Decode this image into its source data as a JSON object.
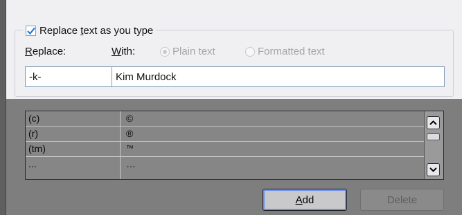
{
  "group": {
    "checkbox_label_pre": "Replace ",
    "checkbox_label_key": "t",
    "checkbox_label_post": "ext as you type",
    "checked": true
  },
  "labels": {
    "replace_key": "R",
    "replace_rest": "eplace:",
    "with_key": "W",
    "with_rest": "ith:"
  },
  "radios": {
    "plain": "Plain text",
    "formatted": "Formatted text"
  },
  "inputs": {
    "replace_value": "-k-",
    "with_value": "Kim Murdock"
  },
  "table": {
    "rows": [
      {
        "replace": "(c)",
        "with": "©"
      },
      {
        "replace": "(r)",
        "with": "®"
      },
      {
        "replace": "(tm)",
        "with": "™"
      },
      {
        "replace": "...",
        "with": "…"
      }
    ]
  },
  "buttons": {
    "add_key": "A",
    "add_rest": "dd",
    "delete": "Delete"
  },
  "colors": {
    "accent": "#2a7ad5",
    "dialog_bg": "#f0f0f2",
    "disabled_area": "#7e7e7e"
  }
}
